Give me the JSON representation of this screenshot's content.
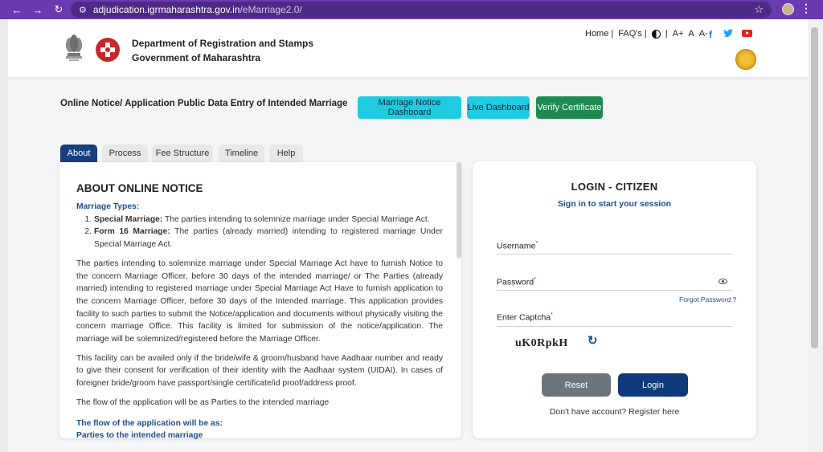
{
  "browser": {
    "url_domain": "adjudication.igrmaharashtra.gov.in",
    "url_path": "/eMarriage2.0/"
  },
  "header": {
    "department_line1": "Department of Registration and Stamps",
    "department_line2": "Government of Maharashtra",
    "links": {
      "home": "Home |",
      "faqs": "FAQ's |",
      "contrast_sep": "|",
      "font_plus": "A+",
      "font_normal": "A",
      "font_minus": "A-"
    },
    "social": {
      "facebook": "f",
      "twitter": "t"
    }
  },
  "page": {
    "title": "Online Notice/ Application Public Data Entry of Intended Marriage",
    "buttons": {
      "notice_dashboard": "Marriage Notice Dashboard",
      "live_dashboard": "Live Dashboard",
      "verify_certificate": "Verify Certificate"
    },
    "tabs": [
      "About",
      "Process",
      "Fee Structure",
      "Timeline",
      "Help"
    ]
  },
  "about": {
    "heading": "ABOUT ONLINE NOTICE",
    "marriage_types_label": "Marriage Types:",
    "type1_bold": "Special Marriage:",
    "type1_text": " The parties intending to solemnize marriage under Special Marriage Act.",
    "type2_bold": "Form 16 Marriage:",
    "type2_text": " The parties (already married) intending to registered marriage Under Special Marriage Act.",
    "para1": "The parties intending to solemnize marriage under Special Marriage Act have to furnish Notice to the concern Marriage Officer, before 30 days of the intended marriage/ or The Parties (already married) intending to registered marriage under Special Marriage Act Have to furnish application to the concern Marriage Officer, before 30 days of the Intended marriage. This application provides facility to such parties to submit the Notice/application and documents without physically visiting the concern marriage Office. This facility is limited for submission of the notice/application. The marriage will be solemnized/registered before the Marriage Officer.",
    "para2": "This facility can be availed only if the bride/wife & groom/husband have Aadhaar number and ready to give their consent for verification of their identity with the Aadhaar system (UIDAI). In cases of foreigner bride/groom have passport/single certificate/id proof/address proof.",
    "para3": "The flow of the application will be as Parties to the intended marriage",
    "flow_heading": "The flow of the application will be as:",
    "flow_sub": "Parties to the intended marriage"
  },
  "login": {
    "title": "LOGIN - CITIZEN",
    "subtitle": "Sign in to start your session",
    "username_label": "Username",
    "password_label": "Password",
    "required_mark": "*",
    "forgot_password": "Forgot Password ?",
    "captcha_label": "Enter Captcha",
    "captcha_text": "uK0RpkH",
    "reset_button": "Reset",
    "login_button": "Login",
    "register_text": "Don't have account? Register here"
  },
  "colors": {
    "chrome": "#6a3bb0",
    "tab_active": "#16407e",
    "cyan_button": "#1ecbe1",
    "verify_button": "#1e8a4f",
    "login_button": "#0f3a7a",
    "reset_button": "#6c757d",
    "link_blue": "#1c4f8f"
  },
  "icons": [
    "back-icon",
    "forward-icon",
    "reload-icon",
    "site-info-icon",
    "bookmark-star-icon",
    "extension-icon",
    "browser-menu-icon",
    "emblem-icon",
    "igr-logo-icon",
    "contrast-icon",
    "facebook-icon",
    "twitter-icon",
    "youtube-icon",
    "seal-icon",
    "eye-icon",
    "refresh-icon"
  ]
}
